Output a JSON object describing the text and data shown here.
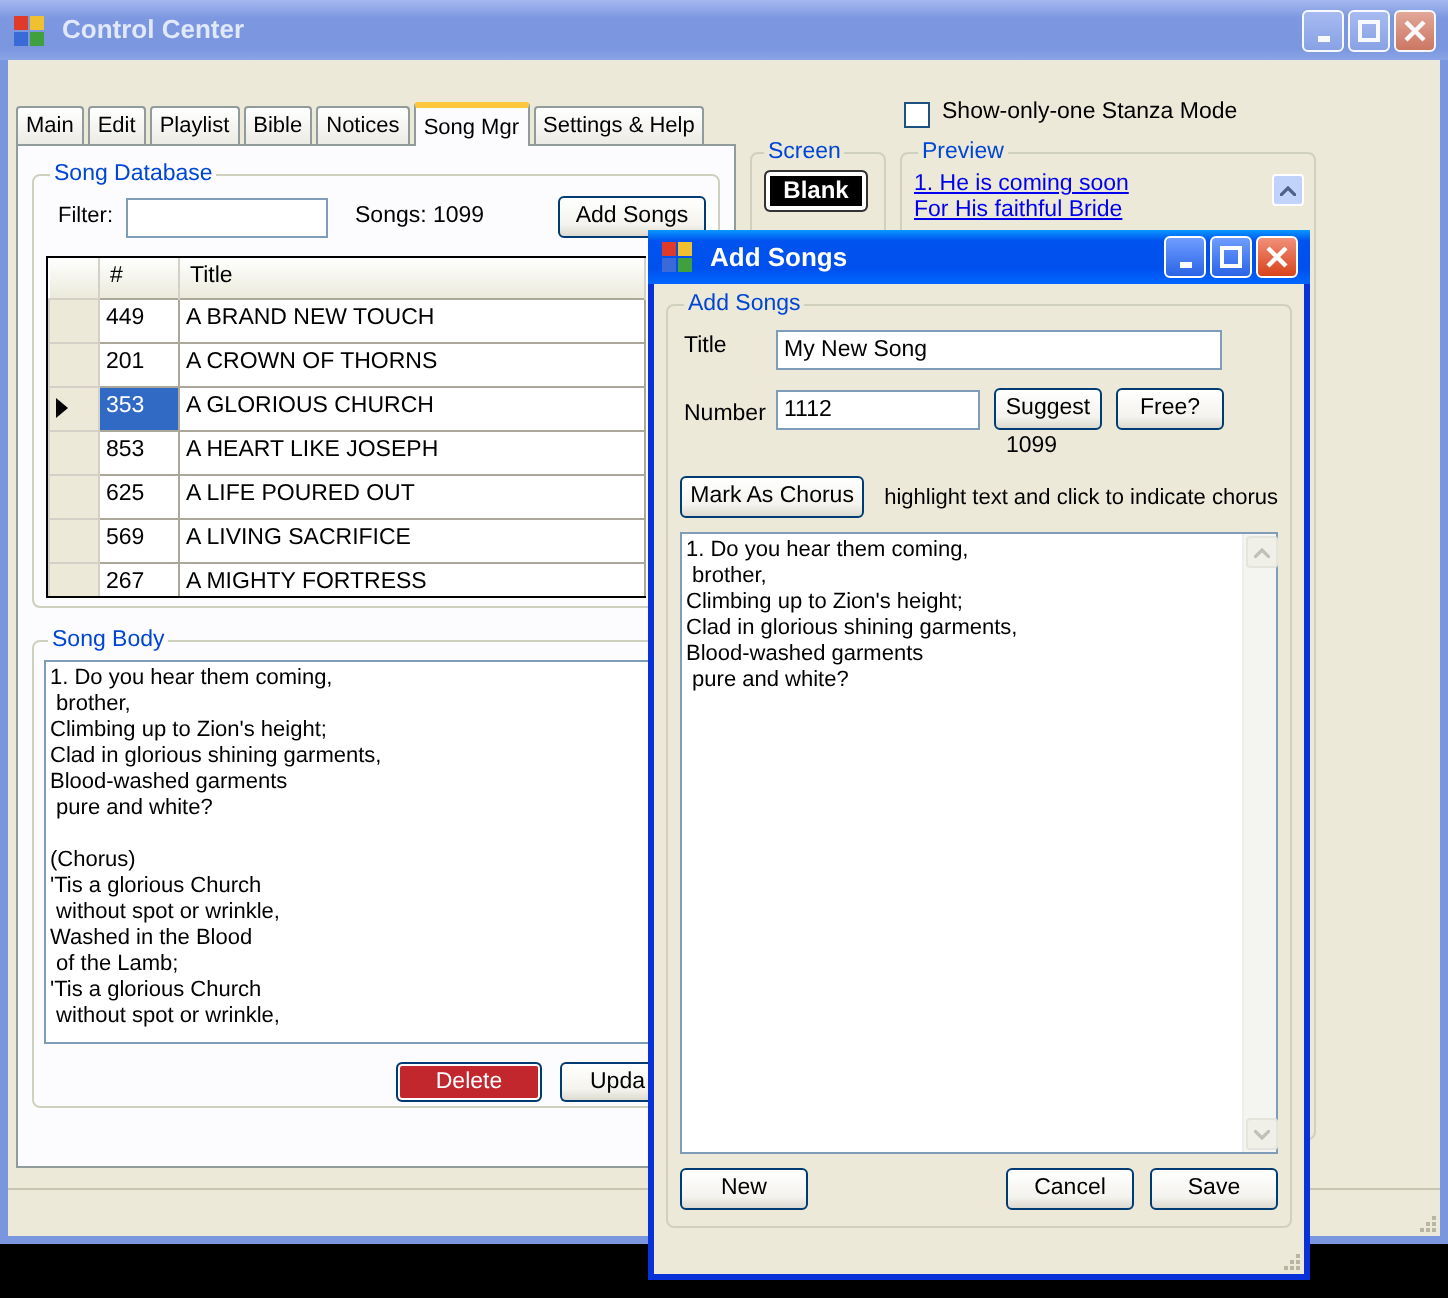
{
  "main_window": {
    "title": "Control Center",
    "active": false
  },
  "tabs": [
    {
      "label": "Main",
      "selected": false
    },
    {
      "label": "Edit",
      "selected": false
    },
    {
      "label": "Playlist",
      "selected": false
    },
    {
      "label": "Bible",
      "selected": false
    },
    {
      "label": "Notices",
      "selected": false
    },
    {
      "label": "Song Mgr",
      "selected": true
    },
    {
      "label": "Settings & Help",
      "selected": false
    }
  ],
  "stanza_mode": {
    "label": "Show-only-one Stanza Mode",
    "checked": false
  },
  "song_database": {
    "title": "Song Database",
    "filter_label": "Filter:",
    "count": "Songs: 1099",
    "add_button": "Add Songs",
    "columns": [
      "#",
      "Title"
    ],
    "rows": [
      {
        "number": "449",
        "title": "A BRAND NEW TOUCH",
        "selected": false
      },
      {
        "number": "201",
        "title": "A CROWN OF THORNS",
        "selected": false
      },
      {
        "number": "353",
        "title": "A GLORIOUS CHURCH",
        "selected": true
      },
      {
        "number": "853",
        "title": "A HEART LIKE JOSEPH",
        "selected": false
      },
      {
        "number": "625",
        "title": "A LIFE POURED OUT",
        "selected": false
      },
      {
        "number": "569",
        "title": "A LIVING SACRIFICE",
        "selected": false
      },
      {
        "number": "267",
        "title": "A MIGHTY FORTRESS",
        "selected": false
      }
    ]
  },
  "song_body": {
    "title": "Song Body",
    "text": "1. Do you hear them coming,\n brother,\nClimbing up to Zion's height;\nClad in glorious shining garments,\nBlood-washed garments\n pure and white?\n\n(Chorus)\n'Tis a glorious Church\n without spot or wrinkle,\nWashed in the Blood\n of the Lamb;\n'Tis a glorious Church\n without spot or wrinkle,",
    "buttons": [
      "Delete",
      "Upda"
    ]
  },
  "screen": {
    "title": "Screen",
    "button": "Blank"
  },
  "preview": {
    "title": "Preview",
    "lines": [
      "1. He is coming soon",
      "For His faithful Bride"
    ]
  },
  "dialog": {
    "title": "Add Songs",
    "active": true,
    "group_title": "Add Songs",
    "title_label": "Title",
    "title_value": "My New Song",
    "number_label": "Number",
    "number_value": "1112",
    "suggest_button": "Suggest",
    "free_button": "Free?",
    "suggestion": "1099",
    "chorus_button": "Mark As Chorus",
    "chorus_hint": "highlight text and click to indicate chorus",
    "text": "1. Do you hear them coming,\n brother,\nClimbing up to Zion's height;\nClad in glorious shining garments,\nBlood-washed garments\n pure and white?",
    "buttons": [
      {
        "label": "New",
        "kind": "left"
      },
      {
        "label": "Cancel",
        "kind": "right"
      },
      {
        "label": "Save",
        "kind": "right"
      }
    ]
  }
}
